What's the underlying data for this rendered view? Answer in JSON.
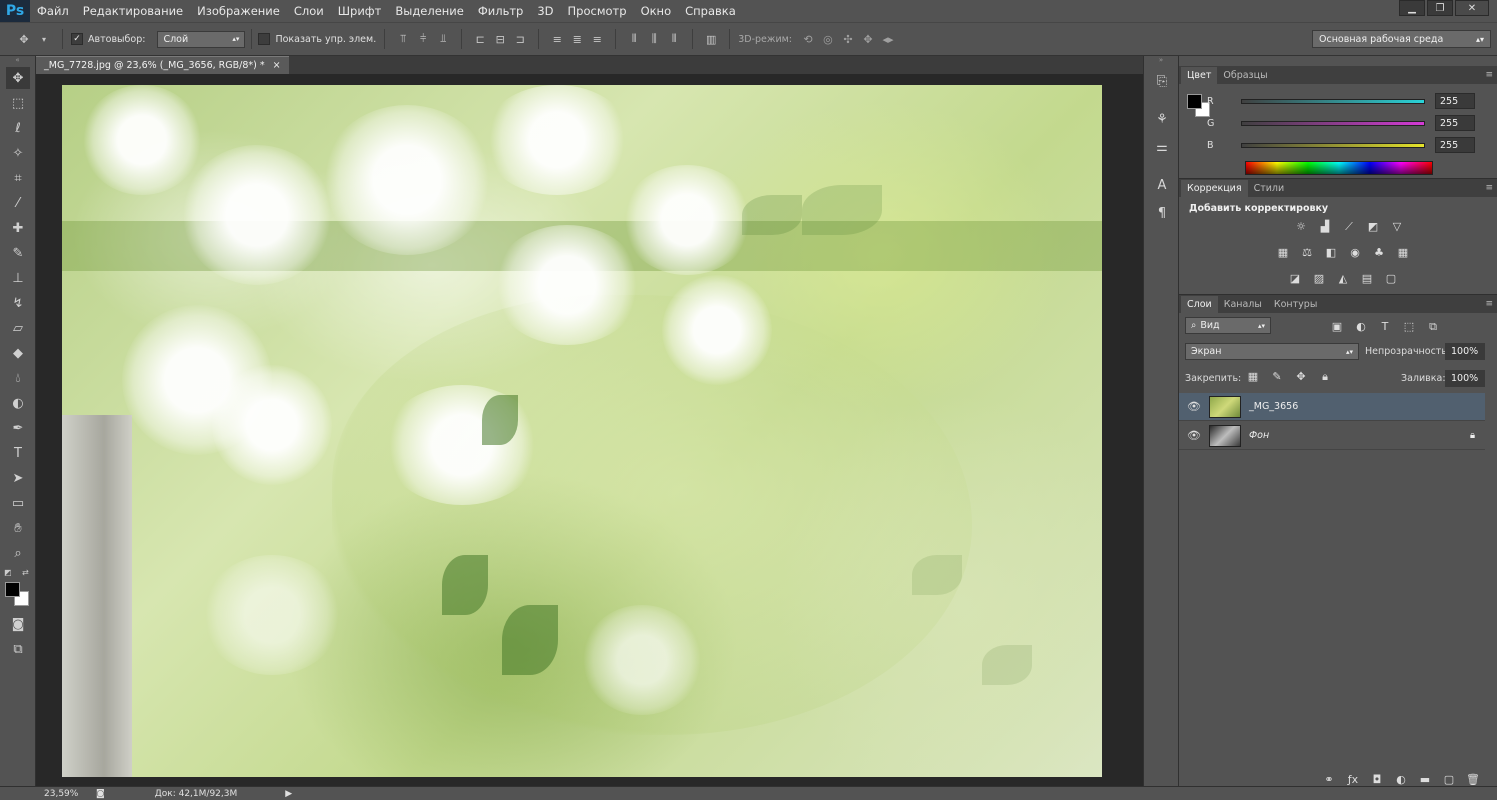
{
  "menubar": {
    "logo": "Ps",
    "items": [
      "Файл",
      "Редактирование",
      "Изображение",
      "Слои",
      "Шрифт",
      "Выделение",
      "Фильтр",
      "3D",
      "Просмотр",
      "Окно",
      "Справка"
    ]
  },
  "options": {
    "autoselect_label": "Автовыбор:",
    "autoselect_value": "Слой",
    "show_transform_label": "Показать упр. элем.",
    "mode3d_label": "3D-режим:",
    "workspace": "Основная рабочая среда"
  },
  "document": {
    "tab_title": "_MG_7728.jpg @ 23,6% (_MG_3656, RGB/8*) *",
    "close_glyph": "×"
  },
  "color_panel": {
    "tabs": [
      "Цвет",
      "Образцы"
    ],
    "channels": [
      {
        "label": "R",
        "value": "255",
        "color": "#29d3d8"
      },
      {
        "label": "G",
        "value": "255",
        "color": "#d43ad6"
      },
      {
        "label": "B",
        "value": "255",
        "color": "#e6e42a"
      }
    ]
  },
  "adjust_panel": {
    "tabs": [
      "Коррекция",
      "Стили"
    ],
    "heading": "Добавить корректировку"
  },
  "layers_panel": {
    "tabs": [
      "Слои",
      "Каналы",
      "Контуры"
    ],
    "filter_value": "Вид",
    "blend_mode": "Экран",
    "opacity_label": "Непрозрачность:",
    "opacity_value": "100%",
    "lock_label": "Закрепить:",
    "fill_label": "Заливка:",
    "fill_value": "100%",
    "layers": [
      {
        "name": "_MG_3656",
        "selected": true
      },
      {
        "name": "Фон",
        "selected": false
      }
    ]
  },
  "status": {
    "zoom": "23,59%",
    "doc_info": "Док: 42,1M/92,3M"
  },
  "colors": {
    "fg": "#000000",
    "bg": "#ffffff",
    "selected_layer": "#51606f"
  }
}
